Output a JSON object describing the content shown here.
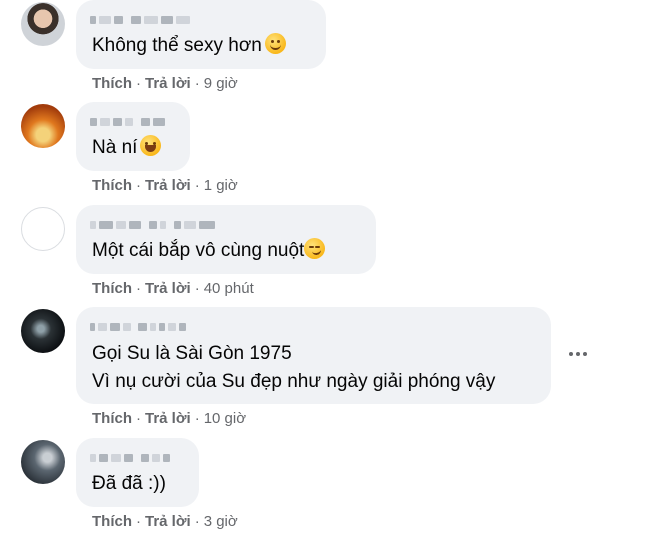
{
  "comments": [
    {
      "text": "Không thể sexy hơn",
      "emoji": "smiling-face-icon",
      "like": "Thích",
      "reply": "Trả lời",
      "time": "9 giờ"
    },
    {
      "text": "Nà ní",
      "emoji": "laughing-face-icon",
      "like": "Thích",
      "reply": "Trả lời",
      "time": "1 giờ"
    },
    {
      "text": "Một cái bắp vô cùng nuột",
      "emoji": "smirking-face-icon",
      "like": "Thích",
      "reply": "Trả lời",
      "time": "40 phút"
    },
    {
      "text_line1": "Gọi Su là Sài Gòn 1975",
      "text_line2": "Vì nụ cười của Su đẹp như ngày giải phóng vậy",
      "like": "Thích",
      "reply": "Trả lời",
      "time": "10 giờ"
    },
    {
      "text": "Đã đã :))",
      "like": "Thích",
      "reply": "Trả lời",
      "time": "3 giờ"
    }
  ],
  "colors": {
    "bubble": "#f0f2f5",
    "meta_text": "#65676b",
    "body_text": "#050505"
  },
  "dot_separator": "·"
}
